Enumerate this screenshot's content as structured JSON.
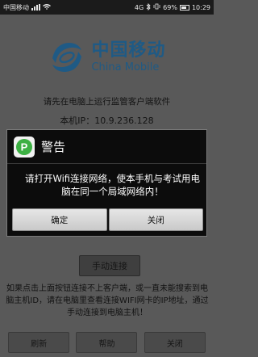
{
  "status_bar": {
    "carrier": "中国移动",
    "network": "4G",
    "battery": "69%",
    "time": "10:29",
    "icons": [
      "signal-icon",
      "wifi-icon",
      "bluetooth-icon",
      "vibrate-icon",
      "battery-icon"
    ]
  },
  "logo": {
    "name_cn": "中国移动",
    "name_en": "China Mobile"
  },
  "main": {
    "instruction": "请先在电脑上运行监管客户端软件",
    "ip_text": "本机IP：10.9.236.128",
    "manual_connect": "手动连接",
    "help_text": "如果点击上面按钮连接不上客户端，或一直未能搜索到电脑主机ID，请在电脑里查看连接WIFI网卡的IP地址，通过手动连接到电脑主机！"
  },
  "bottom_bar": {
    "refresh": "刷新",
    "help": "帮助",
    "close": "关闭"
  },
  "dialog": {
    "title": "警告",
    "message": "请打开Wifi连接网络，使本手机与考试用电脑在同一个局域网络内！",
    "confirm": "确定",
    "close": "关闭",
    "icon_letter": "P"
  },
  "colors": {
    "brand": "#1f5a85",
    "app_icon_green": "#3cb043",
    "overlay": "#595959"
  }
}
